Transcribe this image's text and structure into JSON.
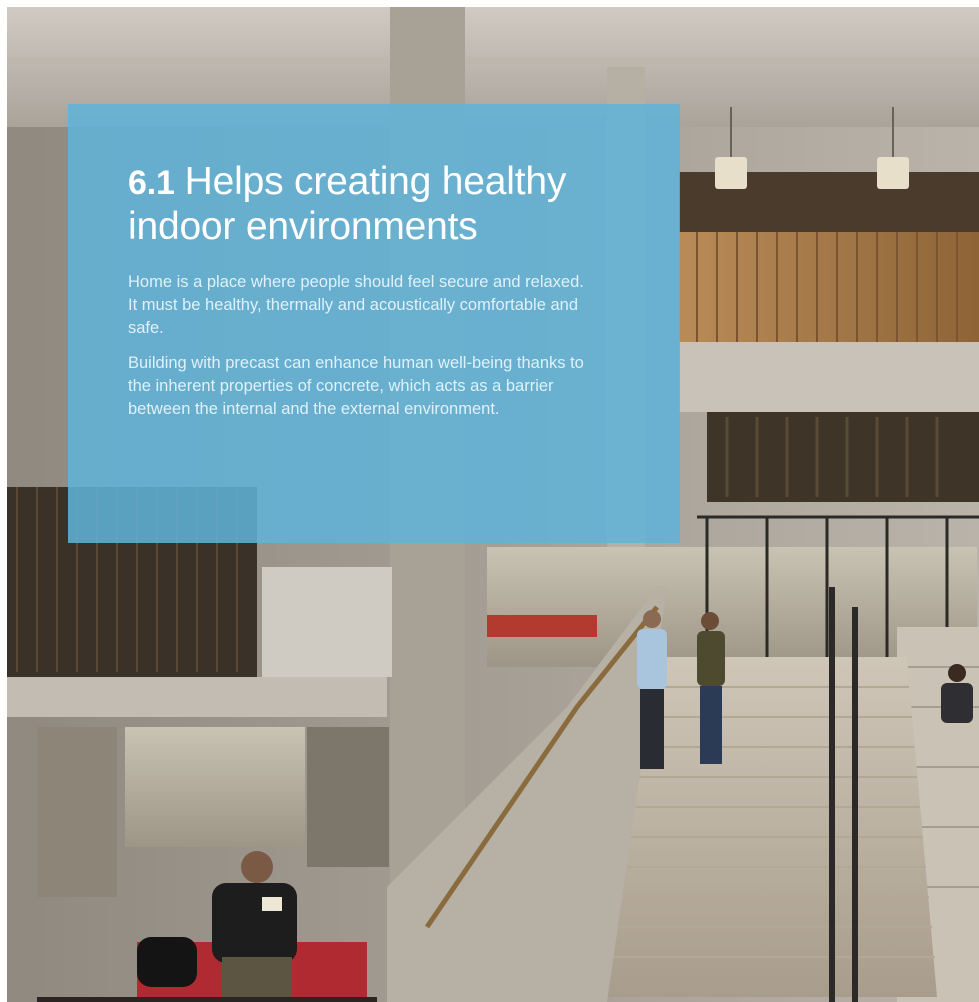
{
  "section": {
    "number": "6.1",
    "title_line1": "Helps creating healthy",
    "title_line2": "indoor environments"
  },
  "paragraphs": [
    "Home is a place where people should feel secure and relaxed. It must be healthy, thermally and acoustically comfortable and safe.",
    "Building with precast can enhance human well-being thanks to the inherent properties of concrete, which acts as a barrier between the internal and the external environment."
  ],
  "colors": {
    "textbox_bg": "#60b2d9",
    "text": "#ffffff"
  }
}
